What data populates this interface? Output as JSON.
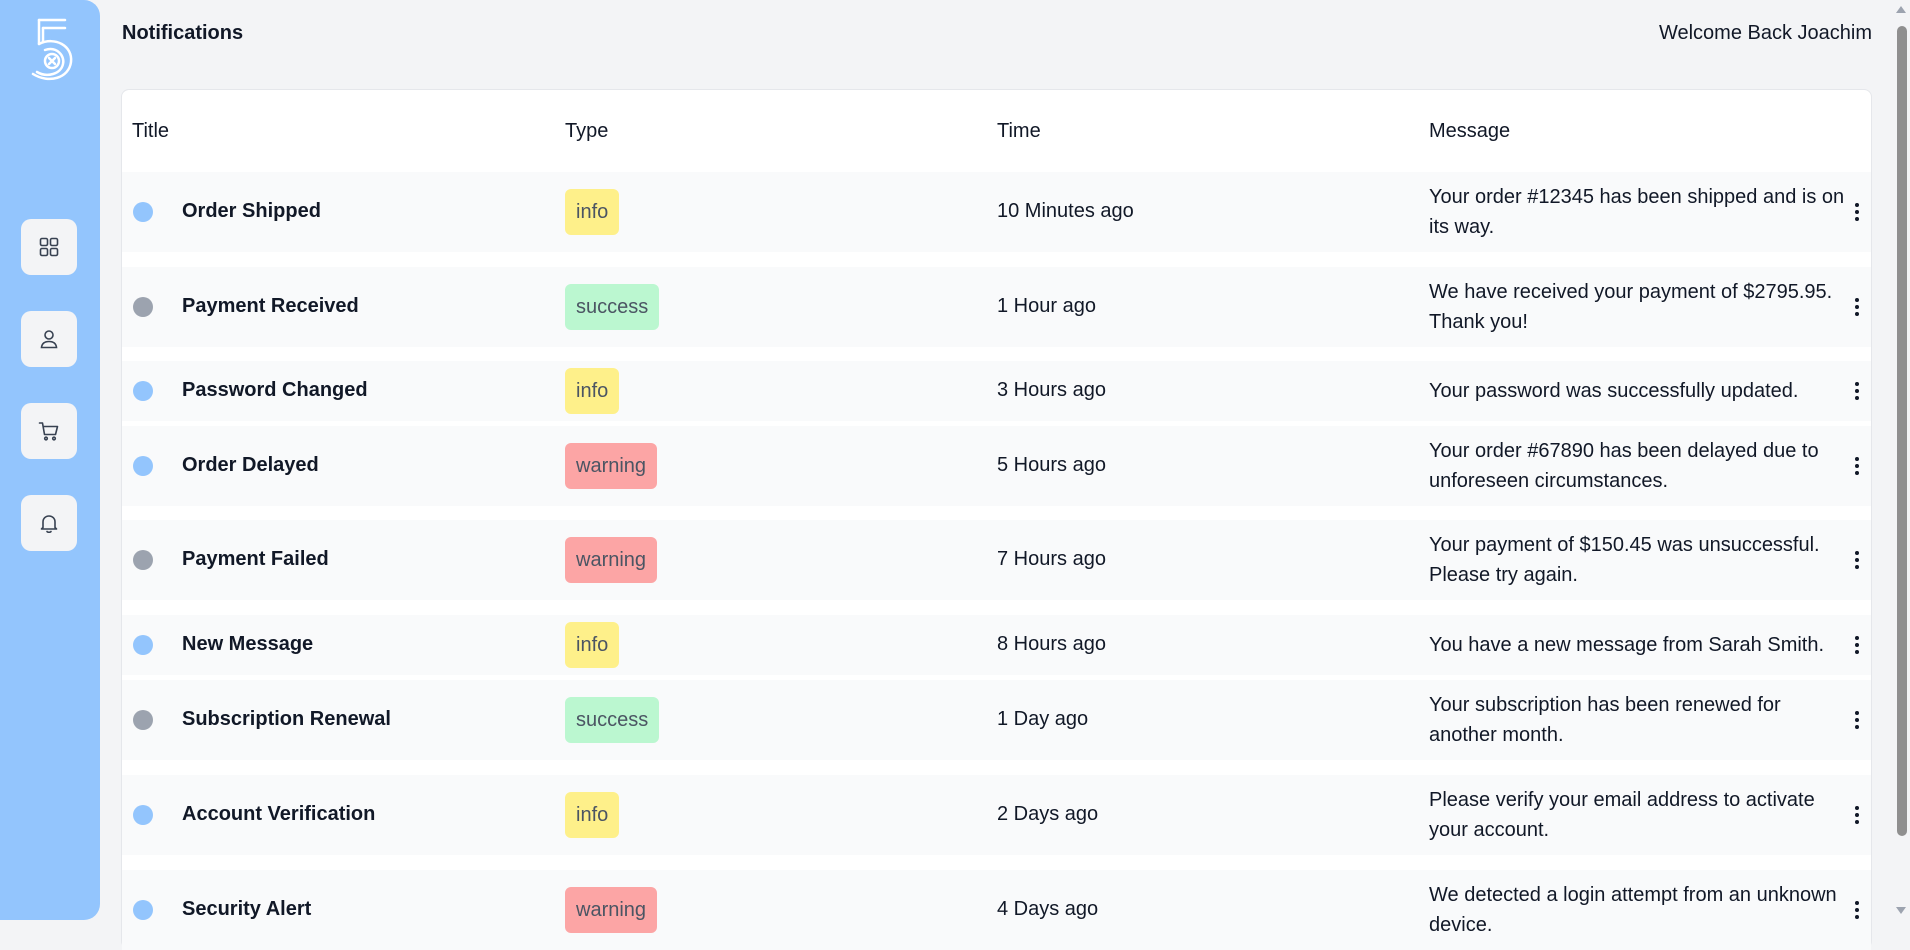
{
  "app": {
    "page_title": "Notifications",
    "welcome_text": "Welcome Back Joachim"
  },
  "sidebar": {
    "logo": "logo-5",
    "items": [
      {
        "name": "dashboard",
        "icon": "grid-icon"
      },
      {
        "name": "profile",
        "icon": "user-icon"
      },
      {
        "name": "cart",
        "icon": "cart-icon"
      },
      {
        "name": "notifications",
        "icon": "bell-icon"
      }
    ]
  },
  "table": {
    "columns": [
      "Title",
      "Type",
      "Time",
      "Message"
    ],
    "rows": [
      {
        "dot": "#93c5fd",
        "title": "Order Shipped",
        "type": "info",
        "time": "10 Minutes ago",
        "message": "Your order #12345 has been shipped and is on its way."
      },
      {
        "dot": "#9ca3af",
        "title": "Payment Received",
        "type": "success",
        "time": "1 Hour ago",
        "message": "We have received your payment of $2795.95. Thank you!"
      },
      {
        "dot": "#93c5fd",
        "title": "Password Changed",
        "type": "info",
        "time": "3 Hours ago",
        "message": "Your password was successfully updated."
      },
      {
        "dot": "#93c5fd",
        "title": "Order Delayed",
        "type": "warning",
        "time": "5 Hours ago",
        "message": "Your order #67890 has been delayed due to unforeseen circumstances."
      },
      {
        "dot": "#9ca3af",
        "title": "Payment Failed",
        "type": "warning",
        "time": "7 Hours ago",
        "message": "Your payment of $150.45 was unsuccessful. Please try again."
      },
      {
        "dot": "#93c5fd",
        "title": "New Message",
        "type": "info",
        "time": "8 Hours ago",
        "message": "You have a new message from Sarah Smith."
      },
      {
        "dot": "#9ca3af",
        "title": "Subscription Renewal",
        "type": "success",
        "time": "1 Day ago",
        "message": "Your subscription has been renewed for another month."
      },
      {
        "dot": "#93c5fd",
        "title": "Account Verification",
        "type": "info",
        "time": "2 Days ago",
        "message": "Please verify your email address to activate your account."
      },
      {
        "dot": "#93c5fd",
        "title": "Security Alert",
        "type": "warning",
        "time": "4 Days ago",
        "message": "We detected a login attempt from an unknown device."
      }
    ]
  },
  "colors": {
    "sidebar": "#93c5fd",
    "badge_info": "#fef08a",
    "badge_success": "#bbf7d0",
    "badge_warning": "#fca5a5",
    "dot_unread": "#93c5fd",
    "dot_read": "#9ca3af"
  }
}
